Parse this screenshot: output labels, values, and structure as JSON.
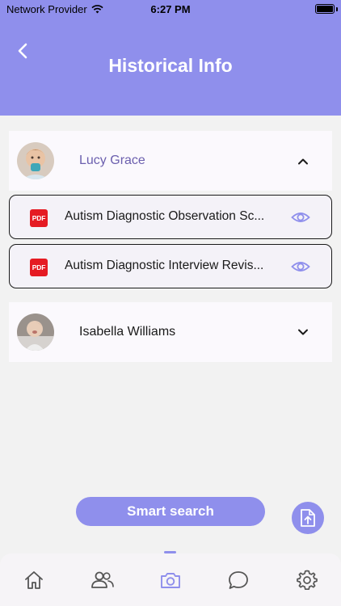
{
  "status_bar": {
    "carrier": "Network Provider",
    "time": "6:27 PM"
  },
  "header": {
    "title": "Historical Info"
  },
  "patients": [
    {
      "name": "Lucy Grace",
      "expanded": true,
      "documents": [
        {
          "title": "Autism Diagnostic Observation Sc...",
          "type_label": "PDF"
        },
        {
          "title": "Autism Diagnostic Interview Revis...",
          "type_label": "PDF"
        }
      ]
    },
    {
      "name": "Isabella Williams",
      "expanded": false,
      "documents": []
    }
  ],
  "actions": {
    "smart_search_label": "Smart search"
  },
  "tabs": [
    "home",
    "patients",
    "camera",
    "chat",
    "settings"
  ],
  "active_tab": "camera",
  "colors": {
    "accent": "#8f8fec",
    "accent_text": "#6b5fae",
    "pdf_red": "#e51b23"
  }
}
